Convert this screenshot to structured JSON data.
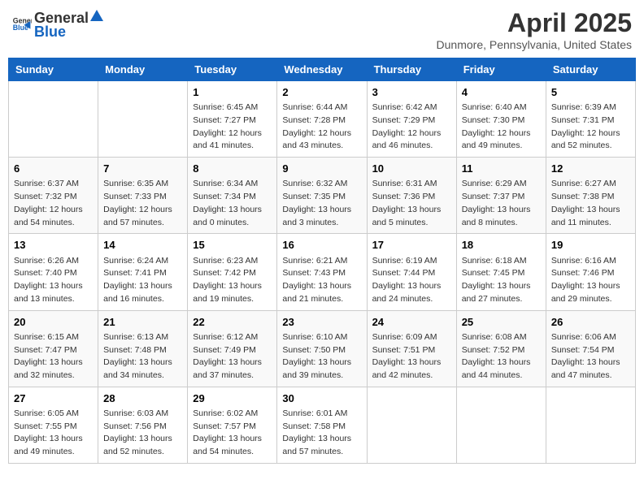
{
  "header": {
    "logo_general": "General",
    "logo_blue": "Blue",
    "month": "April 2025",
    "location": "Dunmore, Pennsylvania, United States"
  },
  "weekdays": [
    "Sunday",
    "Monday",
    "Tuesday",
    "Wednesday",
    "Thursday",
    "Friday",
    "Saturday"
  ],
  "weeks": [
    [
      {
        "day": "",
        "info": ""
      },
      {
        "day": "",
        "info": ""
      },
      {
        "day": "1",
        "info": "Sunrise: 6:45 AM\nSunset: 7:27 PM\nDaylight: 12 hours and 41 minutes."
      },
      {
        "day": "2",
        "info": "Sunrise: 6:44 AM\nSunset: 7:28 PM\nDaylight: 12 hours and 43 minutes."
      },
      {
        "day": "3",
        "info": "Sunrise: 6:42 AM\nSunset: 7:29 PM\nDaylight: 12 hours and 46 minutes."
      },
      {
        "day": "4",
        "info": "Sunrise: 6:40 AM\nSunset: 7:30 PM\nDaylight: 12 hours and 49 minutes."
      },
      {
        "day": "5",
        "info": "Sunrise: 6:39 AM\nSunset: 7:31 PM\nDaylight: 12 hours and 52 minutes."
      }
    ],
    [
      {
        "day": "6",
        "info": "Sunrise: 6:37 AM\nSunset: 7:32 PM\nDaylight: 12 hours and 54 minutes."
      },
      {
        "day": "7",
        "info": "Sunrise: 6:35 AM\nSunset: 7:33 PM\nDaylight: 12 hours and 57 minutes."
      },
      {
        "day": "8",
        "info": "Sunrise: 6:34 AM\nSunset: 7:34 PM\nDaylight: 13 hours and 0 minutes."
      },
      {
        "day": "9",
        "info": "Sunrise: 6:32 AM\nSunset: 7:35 PM\nDaylight: 13 hours and 3 minutes."
      },
      {
        "day": "10",
        "info": "Sunrise: 6:31 AM\nSunset: 7:36 PM\nDaylight: 13 hours and 5 minutes."
      },
      {
        "day": "11",
        "info": "Sunrise: 6:29 AM\nSunset: 7:37 PM\nDaylight: 13 hours and 8 minutes."
      },
      {
        "day": "12",
        "info": "Sunrise: 6:27 AM\nSunset: 7:38 PM\nDaylight: 13 hours and 11 minutes."
      }
    ],
    [
      {
        "day": "13",
        "info": "Sunrise: 6:26 AM\nSunset: 7:40 PM\nDaylight: 13 hours and 13 minutes."
      },
      {
        "day": "14",
        "info": "Sunrise: 6:24 AM\nSunset: 7:41 PM\nDaylight: 13 hours and 16 minutes."
      },
      {
        "day": "15",
        "info": "Sunrise: 6:23 AM\nSunset: 7:42 PM\nDaylight: 13 hours and 19 minutes."
      },
      {
        "day": "16",
        "info": "Sunrise: 6:21 AM\nSunset: 7:43 PM\nDaylight: 13 hours and 21 minutes."
      },
      {
        "day": "17",
        "info": "Sunrise: 6:19 AM\nSunset: 7:44 PM\nDaylight: 13 hours and 24 minutes."
      },
      {
        "day": "18",
        "info": "Sunrise: 6:18 AM\nSunset: 7:45 PM\nDaylight: 13 hours and 27 minutes."
      },
      {
        "day": "19",
        "info": "Sunrise: 6:16 AM\nSunset: 7:46 PM\nDaylight: 13 hours and 29 minutes."
      }
    ],
    [
      {
        "day": "20",
        "info": "Sunrise: 6:15 AM\nSunset: 7:47 PM\nDaylight: 13 hours and 32 minutes."
      },
      {
        "day": "21",
        "info": "Sunrise: 6:13 AM\nSunset: 7:48 PM\nDaylight: 13 hours and 34 minutes."
      },
      {
        "day": "22",
        "info": "Sunrise: 6:12 AM\nSunset: 7:49 PM\nDaylight: 13 hours and 37 minutes."
      },
      {
        "day": "23",
        "info": "Sunrise: 6:10 AM\nSunset: 7:50 PM\nDaylight: 13 hours and 39 minutes."
      },
      {
        "day": "24",
        "info": "Sunrise: 6:09 AM\nSunset: 7:51 PM\nDaylight: 13 hours and 42 minutes."
      },
      {
        "day": "25",
        "info": "Sunrise: 6:08 AM\nSunset: 7:52 PM\nDaylight: 13 hours and 44 minutes."
      },
      {
        "day": "26",
        "info": "Sunrise: 6:06 AM\nSunset: 7:54 PM\nDaylight: 13 hours and 47 minutes."
      }
    ],
    [
      {
        "day": "27",
        "info": "Sunrise: 6:05 AM\nSunset: 7:55 PM\nDaylight: 13 hours and 49 minutes."
      },
      {
        "day": "28",
        "info": "Sunrise: 6:03 AM\nSunset: 7:56 PM\nDaylight: 13 hours and 52 minutes."
      },
      {
        "day": "29",
        "info": "Sunrise: 6:02 AM\nSunset: 7:57 PM\nDaylight: 13 hours and 54 minutes."
      },
      {
        "day": "30",
        "info": "Sunrise: 6:01 AM\nSunset: 7:58 PM\nDaylight: 13 hours and 57 minutes."
      },
      {
        "day": "",
        "info": ""
      },
      {
        "day": "",
        "info": ""
      },
      {
        "day": "",
        "info": ""
      }
    ]
  ]
}
